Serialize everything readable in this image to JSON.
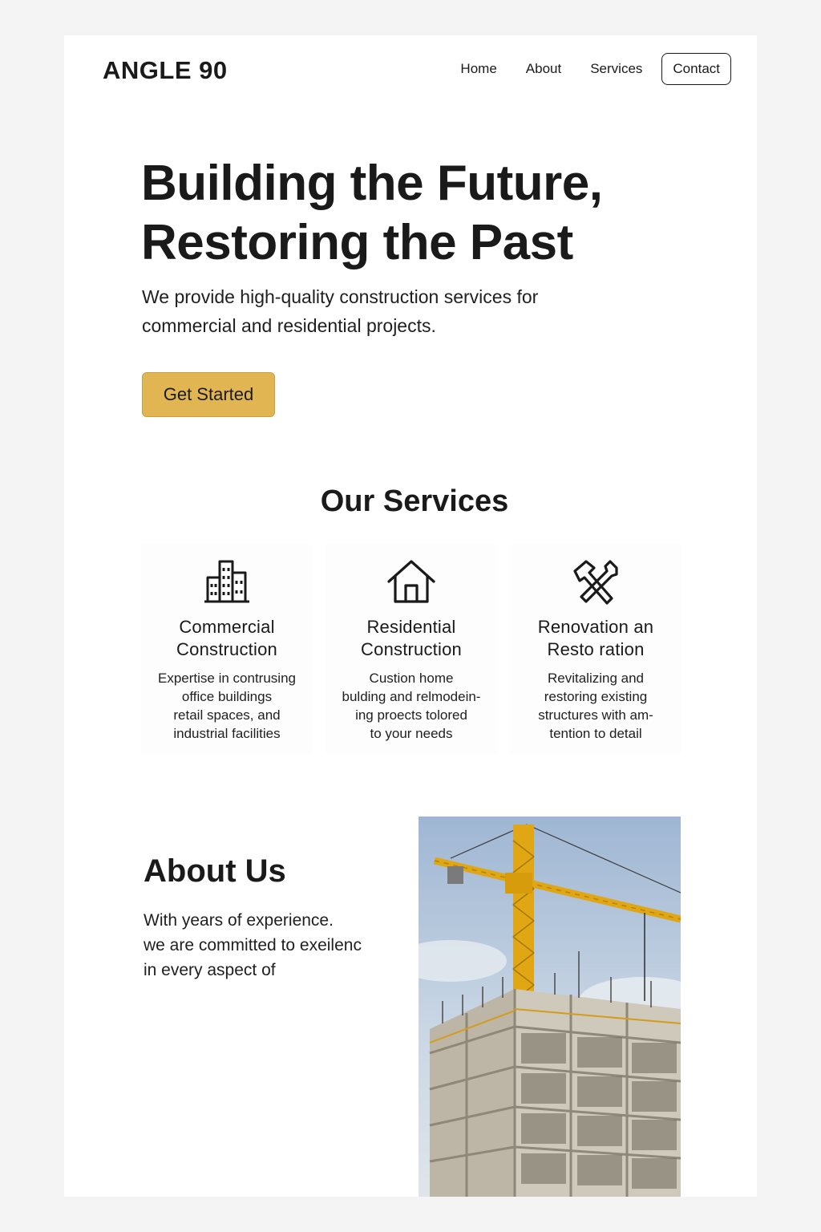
{
  "header": {
    "logo": "ANGLE 90",
    "nav": [
      "Home",
      "About",
      "Services"
    ],
    "contact_label": "Contact"
  },
  "hero": {
    "title_lines": [
      "Building the Future,",
      "Restoring the Past"
    ],
    "subtitle_lines": [
      "We provide high-quality construction services for",
      "commercial and residential projects."
    ],
    "cta_label": "Get Started"
  },
  "services": {
    "title": "Our Services",
    "items": [
      {
        "icon": "building-icon",
        "title_lines": [
          "Commercial",
          "Construction"
        ],
        "desc_lines": [
          "Expertise in contrusing",
          "office buildings",
          "retail spaces, and",
          "industrial facilities"
        ]
      },
      {
        "icon": "house-icon",
        "title_lines": [
          "Residential",
          "Construction"
        ],
        "desc_lines": [
          "Custion home",
          "bulding and relmodein-",
          "ing proects tolored",
          "to your needs"
        ]
      },
      {
        "icon": "hammer-wrench-icon",
        "title_lines": [
          "Renovation an",
          "Resto ration"
        ],
        "desc_lines": [
          "Revitalizing and",
          "restoring existing",
          "structures with am-",
          "tention to detail"
        ]
      }
    ]
  },
  "about": {
    "title": "About Us",
    "text_lines": [
      "With years of experience.",
      "we are committed to exeilenc",
      "in every aspect of"
    ],
    "image": "construction-crane-building-photo"
  },
  "colors": {
    "accent": "#e1b552",
    "text": "#1a1a1a",
    "background": "#ffffff",
    "crane": "#e0a614"
  }
}
